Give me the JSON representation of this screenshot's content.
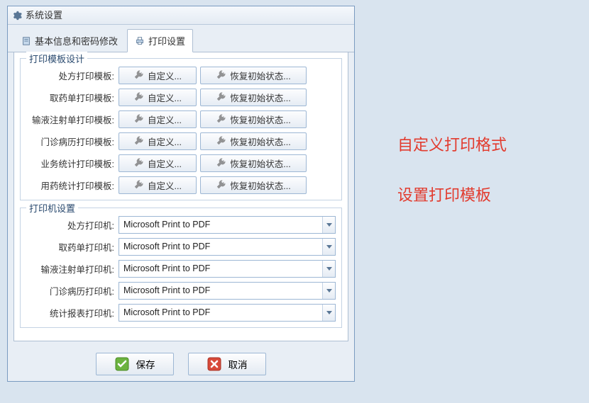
{
  "window": {
    "title": "系统设置"
  },
  "tabs": {
    "t1": "基本信息和密码修改",
    "t2": "打印设置"
  },
  "group_templates": {
    "title": "打印模板设计",
    "customize": "自定义...",
    "reset": "恢复初始状态...",
    "rows": {
      "r0": "处方打印模板:",
      "r1": "取药单打印模板:",
      "r2": "输液注射单打印模板:",
      "r3": "门诊病历打印模板:",
      "r4": "业务统计打印模板:",
      "r5": "用药统计打印模板:"
    }
  },
  "group_printers": {
    "title": "打印机设置",
    "default_printer": "Microsoft Print to PDF",
    "rows": {
      "p0": "处方打印机:",
      "p1": "取药单打印机:",
      "p2": "输液注射单打印机:",
      "p3": "门诊病历打印机:",
      "p4": "统计报表打印机:"
    }
  },
  "buttons": {
    "save": "保存",
    "cancel": "取消"
  },
  "annotations": {
    "a1": "自定义打印格式",
    "a2": "设置打印模板"
  }
}
